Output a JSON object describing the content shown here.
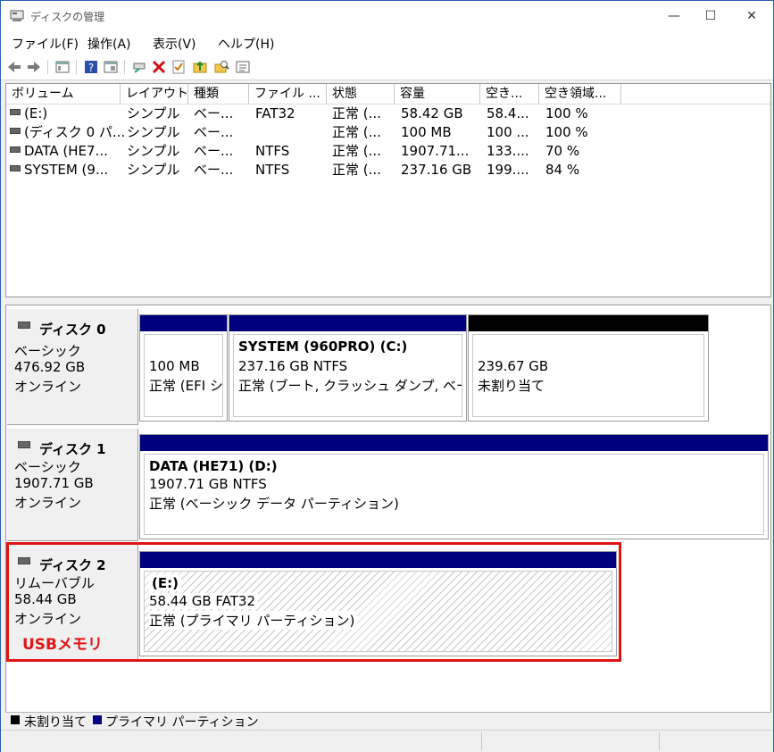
{
  "window": {
    "title": "ディスクの管理",
    "minimize": "—",
    "maximize": "☐",
    "close": "✕"
  },
  "menu": [
    "ファイル(F)",
    "操作(A)",
    "表示(V)",
    "ヘルプ(H)"
  ],
  "toolbar": [
    "back-arrow-icon",
    "forward-arrow-icon",
    "console-tree-icon",
    "help-icon",
    "properties-icon",
    "connect-icon",
    "delete-icon",
    "check-icon",
    "folder-up-icon",
    "search-folder-icon",
    "list-icon"
  ],
  "volume_table": {
    "columns": [
      "ボリューム",
      "レイアウト",
      "種類",
      "ファイル ...",
      "状態",
      "容量",
      "空き...",
      "空き領域..."
    ],
    "rows": [
      [
        "(E:)",
        "シンプル",
        "ベー...",
        "FAT32",
        "正常 (...",
        "58.42 GB",
        "58.4...",
        "100 %"
      ],
      [
        "(ディスク 0 パ...",
        "シンプル",
        "ベー...",
        "",
        "正常 (...",
        "100 MB",
        "100 ...",
        "100 %"
      ],
      [
        "DATA (HE7...",
        "シンプル",
        "ベー...",
        "NTFS",
        "正常 (...",
        "1907.71...",
        "133....",
        "70 %"
      ],
      [
        "SYSTEM (9...",
        "シンプル",
        "ベー...",
        "NTFS",
        "正常 (...",
        "237.16 GB",
        "199....",
        "84 %"
      ]
    ]
  },
  "disks": [
    {
      "name": "ディスク 0",
      "type": "ベーシック",
      "size": "476.92 GB",
      "status": "オンライン",
      "partitions": [
        {
          "title": "",
          "line1": "100 MB",
          "line2": "正常 (EFI シ"
        },
        {
          "title": "SYSTEM (960PRO)  (C:)",
          "line1": "237.16 GB NTFS",
          "line2": "正常 (ブート, クラッシュ ダンプ, ベーシッ"
        },
        {
          "title": "",
          "line1": "239.67 GB",
          "line2": "未割り当て"
        }
      ]
    },
    {
      "name": "ディスク 1",
      "type": "ベーシック",
      "size": "1907.71 GB",
      "status": "オンライン",
      "partitions": [
        {
          "title": "DATA (HE71)  (D:)",
          "line1": "1907.71 GB NTFS",
          "line2": "正常 (ベーシック データ パーティション)"
        }
      ]
    },
    {
      "name": "ディスク 2",
      "type": "リムーバブル",
      "size": "58.44 GB",
      "status": "オンライン",
      "partitions": [
        {
          "title": "(E:)",
          "line1": "58.44 GB FAT32",
          "line2": "正常 (プライマリ パーティション)"
        }
      ]
    }
  ],
  "annotation": "USBメモリ",
  "legend": [
    "未割り当て",
    "プライマリ パーティション"
  ],
  "colors": {
    "primary": "#00007f",
    "unallocated": "#000000",
    "highlight": "#e01414"
  }
}
